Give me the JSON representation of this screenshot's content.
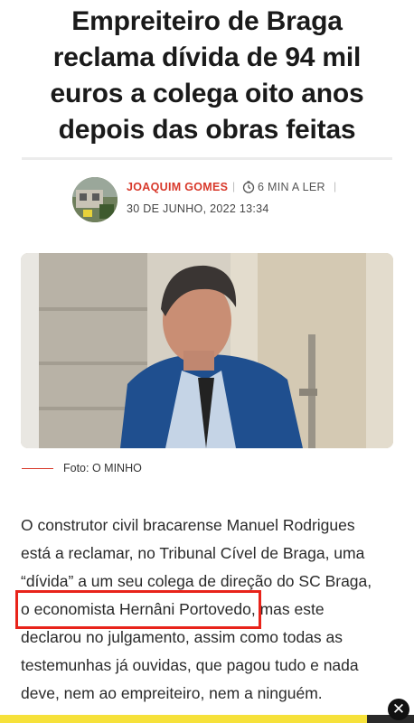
{
  "article": {
    "headline": "Empreiteiro de Braga reclama dívida de 94 mil euros a colega oito anos depois das obras feitas",
    "author": "JOAQUIM GOMES",
    "read_time": "6 MIN A LER",
    "date": "30 DE JUNHO, 2022 13:34",
    "photo_caption": "Foto: O MINHO",
    "body_lines": [
      "O construtor civil bracarense Manuel Rodrigues",
      "está a reclamar, no Tribunal Cível de Braga, uma",
      "“dívida” a um seu colega de direção do SC Braga,",
      "o economista Hernâni Portovedo,",
      " mas este",
      "declarou no julgamento, assim como todas as",
      "testemunhas já ouvidas, que pagou tudo e nada",
      "deve, nem ao empreiteiro, nem a ninguém."
    ]
  },
  "icons": {
    "clock": "clock-icon",
    "close": "close-icon"
  },
  "colors": {
    "accent": "#d8392b",
    "highlight": "#e8231a",
    "ad_bar": "#f6e13a"
  }
}
